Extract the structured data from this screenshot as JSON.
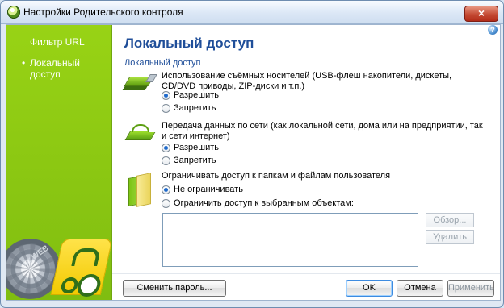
{
  "window": {
    "title": "Настройки Родительского контроля",
    "close_symbol": "×"
  },
  "sidebar": {
    "items": [
      {
        "bullet": "",
        "label": "Фильтр URL"
      },
      {
        "bullet": "•",
        "label": "Локальный доступ"
      }
    ],
    "brand_text": "Dr.WEB"
  },
  "main": {
    "help_symbol": "?",
    "page_title": "Локальный доступ",
    "section_title": "Локальный доступ",
    "usb": {
      "description": "Использование съёмных носителей (USB-флеш накопители, дискеты, CD/DVD приводы, ZIP-диски и т.п.)",
      "options": [
        "Разрешить",
        "Запретить"
      ],
      "selected": "Разрешить"
    },
    "network": {
      "description": "Передача данных по сети (как локальной сети, дома или на предприятии, так и сети интернет)",
      "options": [
        "Разрешить",
        "Запретить"
      ],
      "selected": "Разрешить"
    },
    "folders": {
      "description": "Ограничивать доступ к папкам и файлам пользователя",
      "options": [
        "Не ограничивать",
        "Ограничить доступ к выбранным объектам:"
      ],
      "selected": "Не ограничивать"
    },
    "buttons": {
      "browse": "Обзор...",
      "remove": "Удалить"
    }
  },
  "footer": {
    "change_password": "Сменить пароль...",
    "ok": "OK",
    "cancel": "Отмена",
    "apply": "Применить"
  }
}
